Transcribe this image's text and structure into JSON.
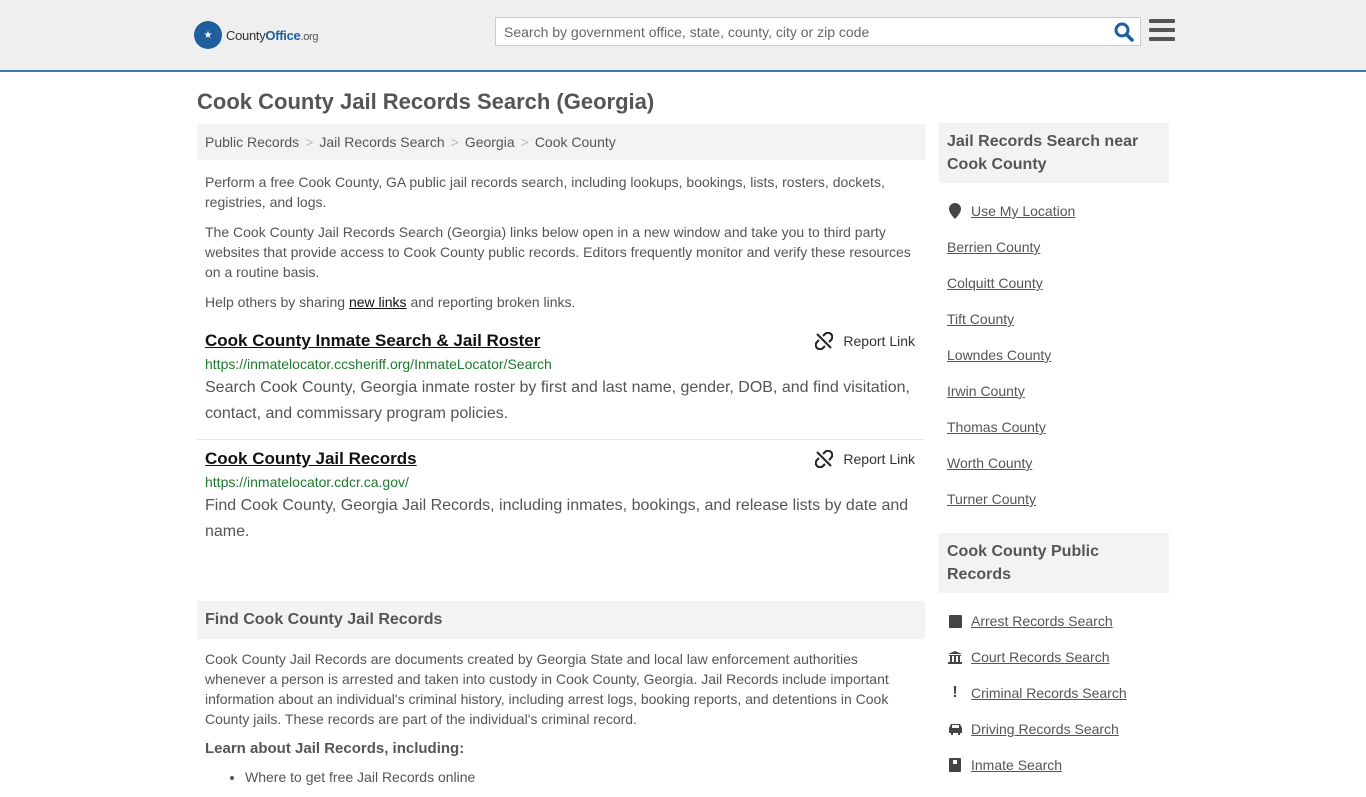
{
  "header": {
    "logo_main": "County",
    "logo_bold": "Office",
    "logo_suffix": ".org",
    "search_placeholder": "Search by government office, state, county, city or zip code"
  },
  "page_title": "Cook County Jail Records Search (Georgia)",
  "breadcrumb": [
    "Public Records",
    "Jail Records Search",
    "Georgia",
    "Cook County"
  ],
  "intro": {
    "p1": "Perform a free Cook County, GA public jail records search, including lookups, bookings, lists, rosters, dockets, registries, and logs.",
    "p2": "The Cook County Jail Records Search (Georgia) links below open in a new window and take you to third party websites that provide access to Cook County public records. Editors frequently monitor and verify these resources on a routine basis.",
    "p3_before": "Help others by sharing ",
    "p3_link": "new links",
    "p3_after": " and reporting broken links."
  },
  "results": [
    {
      "title": "Cook County Inmate Search & Jail Roster",
      "url": "https://inmatelocator.ccsheriff.org/InmateLocator/Search",
      "desc": "Search Cook County, Georgia inmate roster by first and last name, gender, DOB, and find visitation, contact, and commissary program policies.",
      "report_label": "Report Link"
    },
    {
      "title": "Cook County Jail Records",
      "url": "https://inmatelocator.cdcr.ca.gov/",
      "desc": "Find Cook County, Georgia Jail Records, including inmates, bookings, and release lists by date and name.",
      "report_label": "Report Link"
    }
  ],
  "find": {
    "heading": "Find Cook County Jail Records",
    "body": "Cook County Jail Records are documents created by Georgia State and local law enforcement authorities whenever a person is arrested and taken into custody in Cook County, Georgia. Jail Records include important information about an individual's criminal history, including arrest logs, booking reports, and detentions in Cook County jails. These records are part of the individual's criminal record.",
    "learn_heading": "Learn about Jail Records, including:",
    "learn_items": [
      "Where to get free Jail Records online"
    ]
  },
  "sidebar": {
    "nearby_heading": "Jail Records Search near Cook County",
    "use_location": "Use My Location",
    "nearby": [
      "Berrien County",
      "Colquitt County",
      "Tift County",
      "Lowndes County",
      "Irwin County",
      "Thomas County",
      "Worth County",
      "Turner County"
    ],
    "public_heading": "Cook County Public Records",
    "public": [
      {
        "label": "Arrest Records Search",
        "icon": "square-icon"
      },
      {
        "label": "Court Records Search",
        "icon": "courthouse-icon"
      },
      {
        "label": "Criminal Records Search",
        "icon": "exclamation-icon"
      },
      {
        "label": "Driving Records Search",
        "icon": "car-icon"
      },
      {
        "label": "Inmate Search",
        "icon": "id-badge-icon"
      }
    ]
  }
}
